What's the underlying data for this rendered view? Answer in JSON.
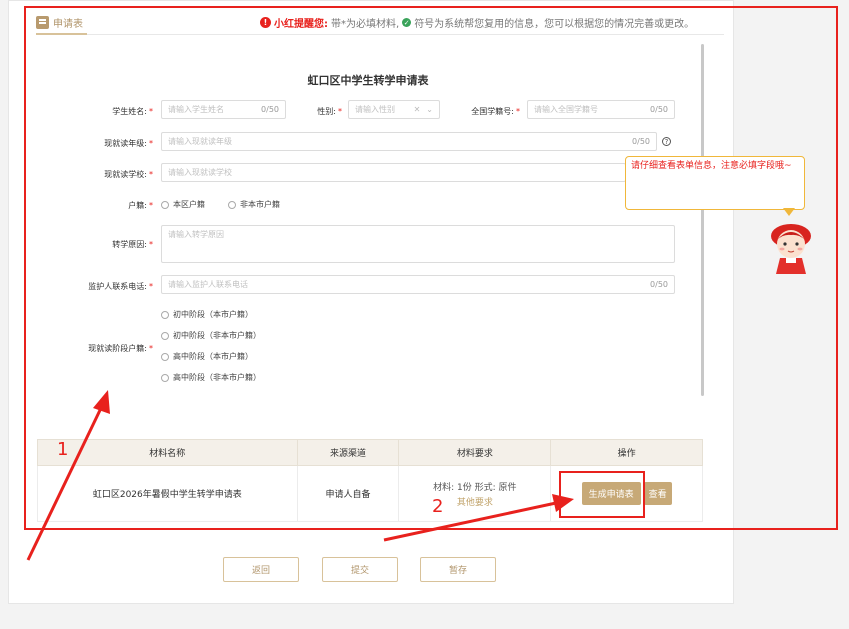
{
  "header": {
    "tab_label": "申请表",
    "notice_title": "小红提醒您:",
    "notice_text_1": "带*为必填材料,",
    "notice_text_2": "符号为系统帮您复用的信息，您可以根据您的情况完善或更改。"
  },
  "form": {
    "title": "虹口区中学生转学申请表",
    "student_name": {
      "label": "学生姓名:",
      "placeholder": "请输入学生姓名",
      "count": "0/50"
    },
    "gender": {
      "label": "性别:",
      "placeholder": "请输入性别"
    },
    "student_id": {
      "label": "全国学籍号:",
      "placeholder": "请输入全国学籍号",
      "count": "0/50"
    },
    "grade": {
      "label": "现就读年级:",
      "placeholder": "请输入现就读年级",
      "count": "0/50"
    },
    "school": {
      "label": "现就读学校:",
      "placeholder": "请输入现就读学校"
    },
    "hukou": {
      "label": "户籍:",
      "options": [
        "本区户籍",
        "非本市户籍"
      ]
    },
    "reason": {
      "label": "转学原因:",
      "placeholder": "请输入转学原因"
    },
    "phone": {
      "label": "监护人联系电话:",
      "placeholder": "请输入监护人联系电话",
      "count": "0/50"
    },
    "stage": {
      "label": "现就读阶段户籍:",
      "options": [
        "初中阶段（本市户籍）",
        "初中阶段（非本市户籍）",
        "高中阶段（本市户籍）",
        "高中阶段（非本市户籍）"
      ]
    }
  },
  "tip": {
    "text": "请仔细查看表单信息，注意必填字段哦~"
  },
  "materials": {
    "headers": [
      "材料名称",
      "来源渠道",
      "材料要求",
      "操作"
    ],
    "row": {
      "name": "虹口区2026年暑假中学生转学申请表",
      "source": "申请人自备",
      "requirement": "材料: 1份 形式: 原件",
      "other": "其他要求",
      "generate": "生成申请表",
      "view": "查看"
    }
  },
  "buttons": {
    "back": "返回",
    "submit": "提交",
    "save": "暂存"
  },
  "annotations": {
    "one": "1",
    "two": "2"
  },
  "colors": {
    "accent": "#c7a977",
    "alert": "#e8211d",
    "tip_border": "#f0b73a"
  }
}
